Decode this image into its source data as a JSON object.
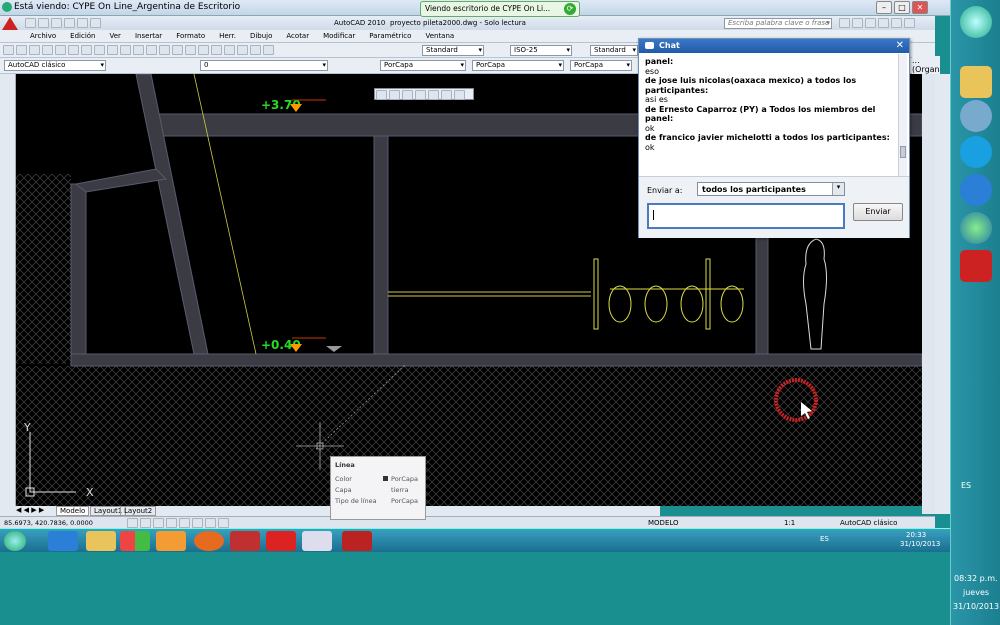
{
  "viewer": {
    "title": "Está viendo: CYPE On Line_Argentina de Escritorio",
    "banner": "Viendo escritorio de CYPE On Li..."
  },
  "acad": {
    "title": "AutoCAD 2010",
    "file": "proyecto pileta2000.dwg - Solo lectura",
    "search_placeholder": "Escriba palabra clave o frase",
    "menus": [
      "Archivo",
      "Edición",
      "Ver",
      "Insertar",
      "Formato",
      "Herr.",
      "Dibujo",
      "Acotar",
      "Modificar",
      "Paramétrico",
      "Ventana"
    ],
    "workspace": "AutoCAD clásico",
    "layer": "0",
    "text_style": "Standard",
    "dim_style": "ISO-25",
    "table_style": "Standard",
    "color": "PorCapa",
    "linetype": "PorCapa",
    "lineweight": "PorCapa",
    "right_cut": "... (Organ",
    "level_top": "+3.70",
    "level_bottom": "+0.40",
    "ucs_x": "X",
    "ucs_y": "Y",
    "tabs": [
      "Modelo",
      "Layout1",
      "Layout2"
    ],
    "coords": "85.6973, 420.7836, 0.0000",
    "status_mode": "MODELO",
    "status_scale": "1:1",
    "status_ws": "AutoCAD clásico"
  },
  "tooltip": {
    "title": "Línea",
    "rows": [
      {
        "k": "Color",
        "v": "PorCapa"
      },
      {
        "k": "Capa",
        "v": "tierra"
      },
      {
        "k": "Tipo de línea",
        "v": "PorCapa"
      }
    ]
  },
  "chat": {
    "title": "Chat",
    "lines": [
      {
        "bold": true,
        "text": "panel:"
      },
      {
        "bold": false,
        "text": "eso"
      },
      {
        "bold": true,
        "text": "de jose luis nicolas(oaxaca mexico) a todos los participantes:"
      },
      {
        "bold": false,
        "text": "asi es"
      },
      {
        "bold": true,
        "text": "de Ernesto Caparroz (PY) a Todos los miembros del panel:"
      },
      {
        "bold": false,
        "text": "ok"
      },
      {
        "bold": true,
        "text": "de francico javier michelotti a todos los participantes:"
      },
      {
        "bold": false,
        "text": "ok"
      }
    ],
    "send_to_label": "Enviar a:",
    "send_to_value": "todos los participantes",
    "send_button": "Enviar"
  },
  "taskbar": {
    "lang": "ES",
    "time": "20:33",
    "date": "31/10/2013"
  },
  "winbar": {
    "lang": "ES",
    "time": "08:32 p.m.",
    "day": "jueves",
    "date": "31/10/2013"
  }
}
